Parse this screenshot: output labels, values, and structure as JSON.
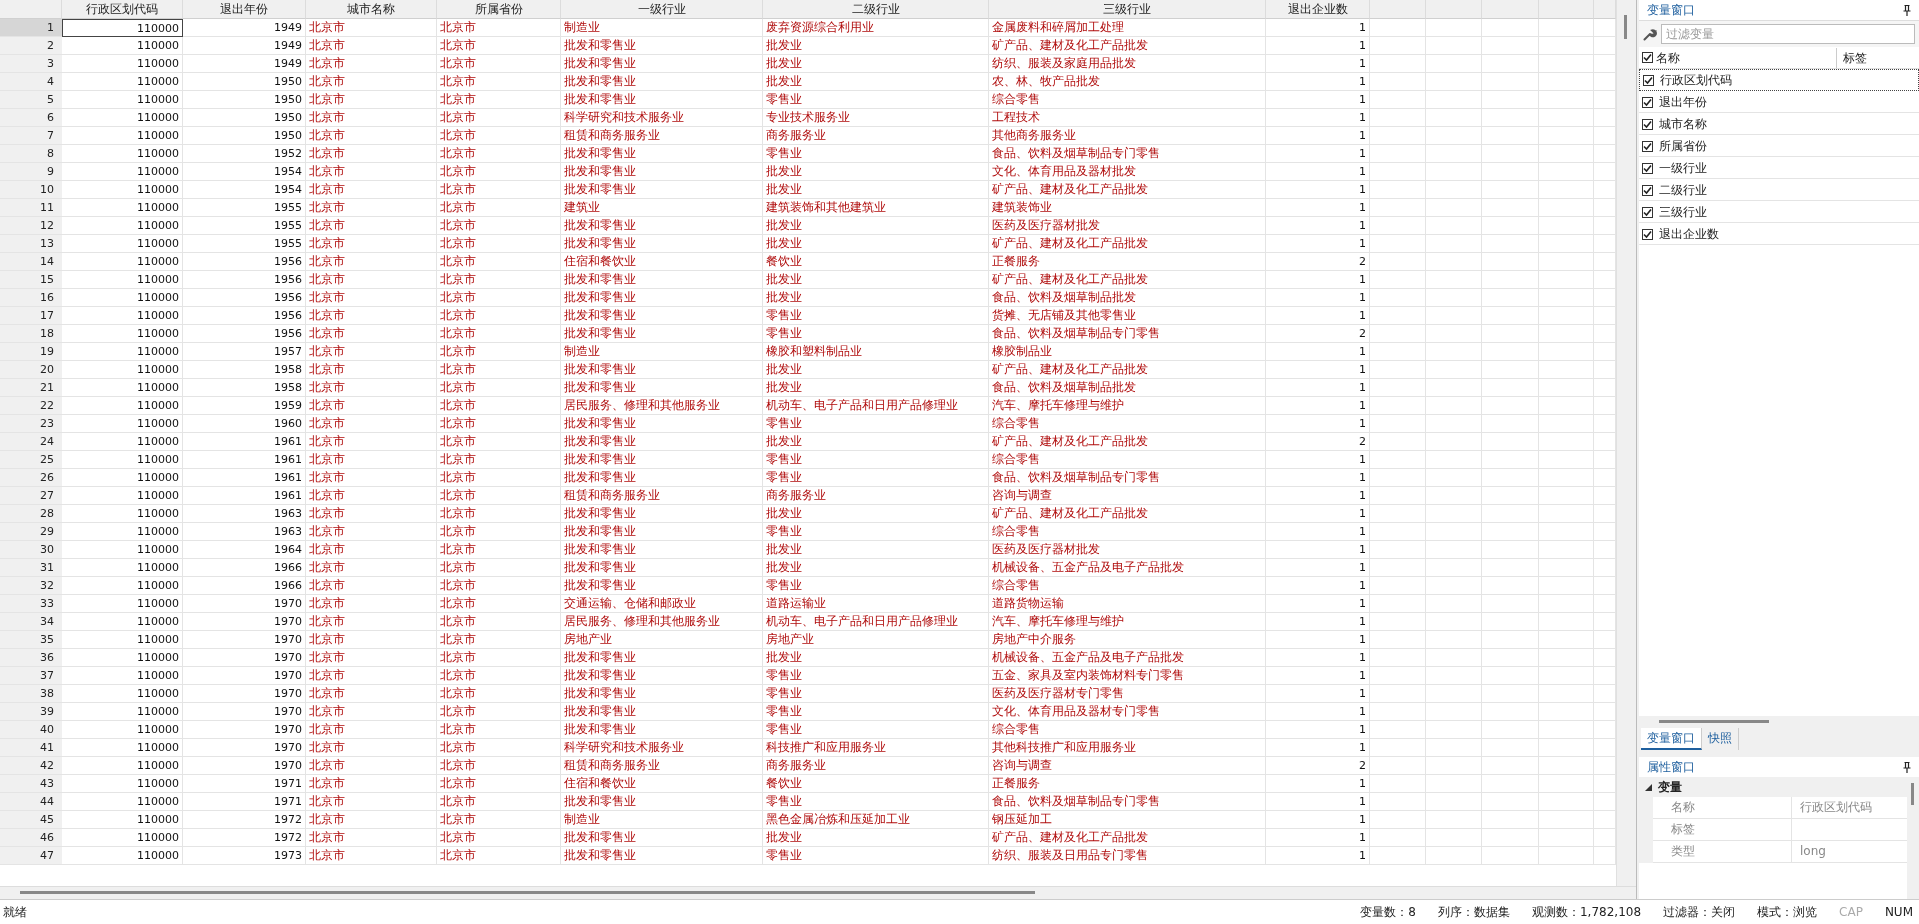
{
  "table": {
    "columns": [
      {
        "label": "行政区划代码",
        "kind": "numeric"
      },
      {
        "label": "退出年份",
        "kind": "numeric"
      },
      {
        "label": "城市名称",
        "kind": "string"
      },
      {
        "label": "所属省份",
        "kind": "string"
      },
      {
        "label": "一级行业",
        "kind": "string"
      },
      {
        "label": "二级行业",
        "kind": "string"
      },
      {
        "label": "三级行业",
        "kind": "string"
      },
      {
        "label": "退出企业数",
        "kind": "numeric"
      }
    ],
    "rows": [
      {
        "number": "1",
        "selected": true,
        "cells": [
          "110000",
          "1949",
          "北京市",
          "北京市",
          "制造业",
          "废弃资源综合利用业",
          "金属废料和碎屑加工处理",
          "1"
        ]
      },
      {
        "number": "2",
        "selected": false,
        "cells": [
          "110000",
          "1949",
          "北京市",
          "北京市",
          "批发和零售业",
          "批发业",
          "矿产品、建材及化工产品批发",
          "1"
        ]
      },
      {
        "number": "3",
        "selected": false,
        "cells": [
          "110000",
          "1949",
          "北京市",
          "北京市",
          "批发和零售业",
          "批发业",
          "纺织、服装及家庭用品批发",
          "1"
        ]
      },
      {
        "number": "4",
        "selected": false,
        "cells": [
          "110000",
          "1950",
          "北京市",
          "北京市",
          "批发和零售业",
          "批发业",
          "农、林、牧产品批发",
          "1"
        ]
      },
      {
        "number": "5",
        "selected": false,
        "cells": [
          "110000",
          "1950",
          "北京市",
          "北京市",
          "批发和零售业",
          "零售业",
          "综合零售",
          "1"
        ]
      },
      {
        "number": "6",
        "selected": false,
        "cells": [
          "110000",
          "1950",
          "北京市",
          "北京市",
          "科学研究和技术服务业",
          "专业技术服务业",
          "工程技术",
          "1"
        ]
      },
      {
        "number": "7",
        "selected": false,
        "cells": [
          "110000",
          "1950",
          "北京市",
          "北京市",
          "租赁和商务服务业",
          "商务服务业",
          "其他商务服务业",
          "1"
        ]
      },
      {
        "number": "8",
        "selected": false,
        "cells": [
          "110000",
          "1952",
          "北京市",
          "北京市",
          "批发和零售业",
          "零售业",
          "食品、饮料及烟草制品专门零售",
          "1"
        ]
      },
      {
        "number": "9",
        "selected": false,
        "cells": [
          "110000",
          "1954",
          "北京市",
          "北京市",
          "批发和零售业",
          "批发业",
          "文化、体育用品及器材批发",
          "1"
        ]
      },
      {
        "number": "10",
        "selected": false,
        "cells": [
          "110000",
          "1954",
          "北京市",
          "北京市",
          "批发和零售业",
          "批发业",
          "矿产品、建材及化工产品批发",
          "1"
        ]
      },
      {
        "number": "11",
        "selected": false,
        "cells": [
          "110000",
          "1955",
          "北京市",
          "北京市",
          "建筑业",
          "建筑装饰和其他建筑业",
          "建筑装饰业",
          "1"
        ]
      },
      {
        "number": "12",
        "selected": false,
        "cells": [
          "110000",
          "1955",
          "北京市",
          "北京市",
          "批发和零售业",
          "批发业",
          "医药及医疗器材批发",
          "1"
        ]
      },
      {
        "number": "13",
        "selected": false,
        "cells": [
          "110000",
          "1955",
          "北京市",
          "北京市",
          "批发和零售业",
          "批发业",
          "矿产品、建材及化工产品批发",
          "1"
        ]
      },
      {
        "number": "14",
        "selected": false,
        "cells": [
          "110000",
          "1956",
          "北京市",
          "北京市",
          "住宿和餐饮业",
          "餐饮业",
          "正餐服务",
          "2"
        ]
      },
      {
        "number": "15",
        "selected": false,
        "cells": [
          "110000",
          "1956",
          "北京市",
          "北京市",
          "批发和零售业",
          "批发业",
          "矿产品、建材及化工产品批发",
          "1"
        ]
      },
      {
        "number": "16",
        "selected": false,
        "cells": [
          "110000",
          "1956",
          "北京市",
          "北京市",
          "批发和零售业",
          "批发业",
          "食品、饮料及烟草制品批发",
          "1"
        ]
      },
      {
        "number": "17",
        "selected": false,
        "cells": [
          "110000",
          "1956",
          "北京市",
          "北京市",
          "批发和零售业",
          "零售业",
          "货摊、无店铺及其他零售业",
          "1"
        ]
      },
      {
        "number": "18",
        "selected": false,
        "cells": [
          "110000",
          "1956",
          "北京市",
          "北京市",
          "批发和零售业",
          "零售业",
          "食品、饮料及烟草制品专门零售",
          "2"
        ]
      },
      {
        "number": "19",
        "selected": false,
        "cells": [
          "110000",
          "1957",
          "北京市",
          "北京市",
          "制造业",
          "橡胶和塑料制品业",
          "橡胶制品业",
          "1"
        ]
      },
      {
        "number": "20",
        "selected": false,
        "cells": [
          "110000",
          "1958",
          "北京市",
          "北京市",
          "批发和零售业",
          "批发业",
          "矿产品、建材及化工产品批发",
          "1"
        ]
      },
      {
        "number": "21",
        "selected": false,
        "cells": [
          "110000",
          "1958",
          "北京市",
          "北京市",
          "批发和零售业",
          "批发业",
          "食品、饮料及烟草制品批发",
          "1"
        ]
      },
      {
        "number": "22",
        "selected": false,
        "cells": [
          "110000",
          "1959",
          "北京市",
          "北京市",
          "居民服务、修理和其他服务业",
          "机动车、电子产品和日用产品修理业",
          "汽车、摩托车修理与维护",
          "1"
        ]
      },
      {
        "number": "23",
        "selected": false,
        "cells": [
          "110000",
          "1960",
          "北京市",
          "北京市",
          "批发和零售业",
          "零售业",
          "综合零售",
          "1"
        ]
      },
      {
        "number": "24",
        "selected": false,
        "cells": [
          "110000",
          "1961",
          "北京市",
          "北京市",
          "批发和零售业",
          "批发业",
          "矿产品、建材及化工产品批发",
          "2"
        ]
      },
      {
        "number": "25",
        "selected": false,
        "cells": [
          "110000",
          "1961",
          "北京市",
          "北京市",
          "批发和零售业",
          "零售业",
          "综合零售",
          "1"
        ]
      },
      {
        "number": "26",
        "selected": false,
        "cells": [
          "110000",
          "1961",
          "北京市",
          "北京市",
          "批发和零售业",
          "零售业",
          "食品、饮料及烟草制品专门零售",
          "1"
        ]
      },
      {
        "number": "27",
        "selected": false,
        "cells": [
          "110000",
          "1961",
          "北京市",
          "北京市",
          "租赁和商务服务业",
          "商务服务业",
          "咨询与调查",
          "1"
        ]
      },
      {
        "number": "28",
        "selected": false,
        "cells": [
          "110000",
          "1963",
          "北京市",
          "北京市",
          "批发和零售业",
          "批发业",
          "矿产品、建材及化工产品批发",
          "1"
        ]
      },
      {
        "number": "29",
        "selected": false,
        "cells": [
          "110000",
          "1963",
          "北京市",
          "北京市",
          "批发和零售业",
          "零售业",
          "综合零售",
          "1"
        ]
      },
      {
        "number": "30",
        "selected": false,
        "cells": [
          "110000",
          "1964",
          "北京市",
          "北京市",
          "批发和零售业",
          "批发业",
          "医药及医疗器材批发",
          "1"
        ]
      },
      {
        "number": "31",
        "selected": false,
        "cells": [
          "110000",
          "1966",
          "北京市",
          "北京市",
          "批发和零售业",
          "批发业",
          "机械设备、五金产品及电子产品批发",
          "1"
        ]
      },
      {
        "number": "32",
        "selected": false,
        "cells": [
          "110000",
          "1966",
          "北京市",
          "北京市",
          "批发和零售业",
          "零售业",
          "综合零售",
          "1"
        ]
      },
      {
        "number": "33",
        "selected": false,
        "cells": [
          "110000",
          "1970",
          "北京市",
          "北京市",
          "交通运输、仓储和邮政业",
          "道路运输业",
          "道路货物运输",
          "1"
        ]
      },
      {
        "number": "34",
        "selected": false,
        "cells": [
          "110000",
          "1970",
          "北京市",
          "北京市",
          "居民服务、修理和其他服务业",
          "机动车、电子产品和日用产品修理业",
          "汽车、摩托车修理与维护",
          "1"
        ]
      },
      {
        "number": "35",
        "selected": false,
        "cells": [
          "110000",
          "1970",
          "北京市",
          "北京市",
          "房地产业",
          "房地产业",
          "房地产中介服务",
          "1"
        ]
      },
      {
        "number": "36",
        "selected": false,
        "cells": [
          "110000",
          "1970",
          "北京市",
          "北京市",
          "批发和零售业",
          "批发业",
          "机械设备、五金产品及电子产品批发",
          "1"
        ]
      },
      {
        "number": "37",
        "selected": false,
        "cells": [
          "110000",
          "1970",
          "北京市",
          "北京市",
          "批发和零售业",
          "零售业",
          "五金、家具及室内装饰材料专门零售",
          "1"
        ]
      },
      {
        "number": "38",
        "selected": false,
        "cells": [
          "110000",
          "1970",
          "北京市",
          "北京市",
          "批发和零售业",
          "零售业",
          "医药及医疗器材专门零售",
          "1"
        ]
      },
      {
        "number": "39",
        "selected": false,
        "cells": [
          "110000",
          "1970",
          "北京市",
          "北京市",
          "批发和零售业",
          "零售业",
          "文化、体育用品及器材专门零售",
          "1"
        ]
      },
      {
        "number": "40",
        "selected": false,
        "cells": [
          "110000",
          "1970",
          "北京市",
          "北京市",
          "批发和零售业",
          "零售业",
          "综合零售",
          "1"
        ]
      },
      {
        "number": "41",
        "selected": false,
        "cells": [
          "110000",
          "1970",
          "北京市",
          "北京市",
          "科学研究和技术服务业",
          "科技推广和应用服务业",
          "其他科技推广和应用服务业",
          "1"
        ]
      },
      {
        "number": "42",
        "selected": false,
        "cells": [
          "110000",
          "1970",
          "北京市",
          "北京市",
          "租赁和商务服务业",
          "商务服务业",
          "咨询与调查",
          "2"
        ]
      },
      {
        "number": "43",
        "selected": false,
        "cells": [
          "110000",
          "1971",
          "北京市",
          "北京市",
          "住宿和餐饮业",
          "餐饮业",
          "正餐服务",
          "1"
        ]
      },
      {
        "number": "44",
        "selected": false,
        "cells": [
          "110000",
          "1971",
          "北京市",
          "北京市",
          "批发和零售业",
          "零售业",
          "食品、饮料及烟草制品专门零售",
          "1"
        ]
      },
      {
        "number": "45",
        "selected": false,
        "cells": [
          "110000",
          "1972",
          "北京市",
          "北京市",
          "制造业",
          "黑色金属冶炼和压延加工业",
          "钢压延加工",
          "1"
        ]
      },
      {
        "number": "46",
        "selected": false,
        "cells": [
          "110000",
          "1972",
          "北京市",
          "北京市",
          "批发和零售业",
          "批发业",
          "矿产品、建材及化工产品批发",
          "1"
        ]
      },
      {
        "number": "47",
        "selected": false,
        "cells": [
          "110000",
          "1973",
          "北京市",
          "北京市",
          "批发和零售业",
          "零售业",
          "纺织、服装及日用品专门零售",
          "1"
        ]
      }
    ]
  },
  "variables_panel": {
    "title": "变量窗口",
    "filter": {
      "placeholder": "过滤变量"
    },
    "header": {
      "checked": true,
      "columns": [
        "名称",
        "标签"
      ]
    },
    "variables": [
      {
        "name": "行政区划代码",
        "checked": true,
        "focused": true
      },
      {
        "name": "退出年份",
        "checked": true,
        "focused": false
      },
      {
        "name": "城市名称",
        "checked": true,
        "focused": false
      },
      {
        "name": "所属省份",
        "checked": true,
        "focused": false
      },
      {
        "name": "一级行业",
        "checked": true,
        "focused": false
      },
      {
        "name": "二级行业",
        "checked": true,
        "focused": false
      },
      {
        "name": "三级行业",
        "checked": true,
        "focused": false
      },
      {
        "name": "退出企业数",
        "checked": true,
        "focused": false
      }
    ]
  },
  "panel_tabs": [
    {
      "label": "变量窗口",
      "selected": true
    },
    {
      "label": "快照",
      "selected": false
    }
  ],
  "properties_panel": {
    "title": "属性窗口",
    "group": {
      "label": "变量",
      "expanded": true,
      "properties": [
        {
          "name": "名称",
          "value": "行政区划代码"
        },
        {
          "name": "标签"
        },
        {
          "name": "类型",
          "value": "long"
        }
      ]
    }
  },
  "status_bar": {
    "message": "就绪",
    "items": [
      "变量数：8",
      "列序：数据集",
      "观测数：1,782,108",
      "过滤器：关闭",
      "模式：浏览"
    ],
    "indicators": [
      {
        "label": "CAP",
        "on": false
      },
      {
        "label": "NUM",
        "on": true
      }
    ]
  }
}
